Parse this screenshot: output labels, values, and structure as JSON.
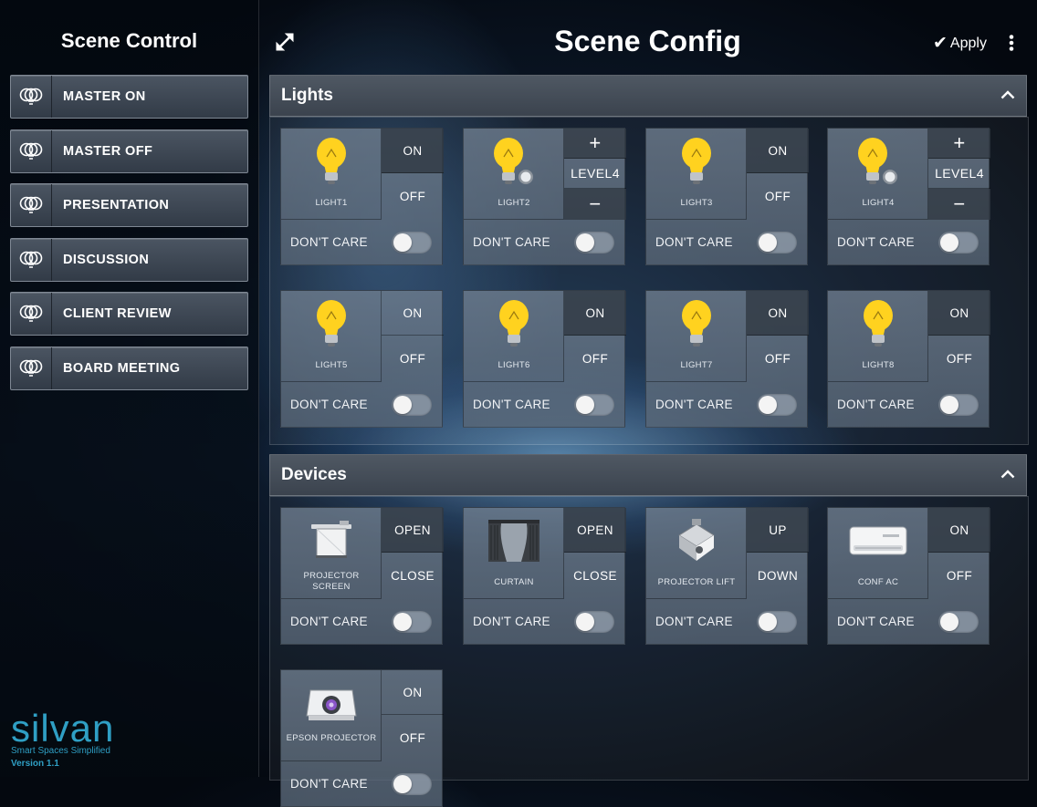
{
  "sidebar": {
    "title": "Scene Control",
    "scenes": [
      {
        "label": "MASTER ON"
      },
      {
        "label": "MASTER OFF"
      },
      {
        "label": "PRESENTATION"
      },
      {
        "label": "DISCUSSION"
      },
      {
        "label": "CLIENT REVIEW"
      },
      {
        "label": "BOARD MEETING"
      }
    ],
    "logo": {
      "word": "silvan",
      "tagline": "Smart Spaces Simplified",
      "version": "Version 1.1"
    }
  },
  "header": {
    "title": "Scene Config",
    "apply_label": "Apply"
  },
  "lights_section": {
    "title": "Lights",
    "tiles": [
      {
        "name": "LIGHT1",
        "type": "onoff",
        "on": "ON",
        "off": "OFF",
        "active": "on",
        "dont_care": "DON'T CARE"
      },
      {
        "name": "LIGHT2",
        "type": "dimmer",
        "plus": "+",
        "level": "LEVEL4",
        "minus": "−",
        "dont_care": "DON'T CARE"
      },
      {
        "name": "LIGHT3",
        "type": "onoff",
        "on": "ON",
        "off": "OFF",
        "active": "on",
        "dont_care": "DON'T CARE"
      },
      {
        "name": "LIGHT4",
        "type": "dimmer",
        "plus": "+",
        "level": "LEVEL4",
        "minus": "−",
        "dont_care": "DON'T CARE"
      },
      {
        "name": "LIGHT5",
        "type": "onoff",
        "on": "ON",
        "off": "OFF",
        "active": "none",
        "dont_care": "DON'T CARE"
      },
      {
        "name": "LIGHT6",
        "type": "onoff",
        "on": "ON",
        "off": "OFF",
        "active": "on",
        "dont_care": "DON'T CARE"
      },
      {
        "name": "LIGHT7",
        "type": "onoff",
        "on": "ON",
        "off": "OFF",
        "active": "on",
        "dont_care": "DON'T CARE"
      },
      {
        "name": "LIGHT8",
        "type": "onoff",
        "on": "ON",
        "off": "OFF",
        "active": "on",
        "dont_care": "DON'T CARE"
      }
    ]
  },
  "devices_section": {
    "title": "Devices",
    "tiles": [
      {
        "name": "PROJECTOR SCREEN",
        "icon": "projector-screen-icon",
        "top": "OPEN",
        "bottom": "CLOSE",
        "dont_care": "DON'T CARE"
      },
      {
        "name": "CURTAIN",
        "icon": "curtain-icon",
        "top": "OPEN",
        "bottom": "CLOSE",
        "dont_care": "DON'T CARE"
      },
      {
        "name": "PROJECTOR LIFT",
        "icon": "projector-lift-icon",
        "top": "UP",
        "bottom": "DOWN",
        "dont_care": "DON'T CARE"
      },
      {
        "name": "CONF AC",
        "icon": "air-conditioner-icon",
        "top": "ON",
        "bottom": "OFF",
        "dont_care": "DON'T CARE"
      },
      {
        "name": "EPSON PROJECTOR",
        "icon": "projector-icon",
        "top": "ON",
        "bottom": "OFF",
        "dont_care": "DON'T CARE"
      }
    ]
  },
  "colors": {
    "accent": "#2f9fc4",
    "bulb": "#ffd21f"
  }
}
